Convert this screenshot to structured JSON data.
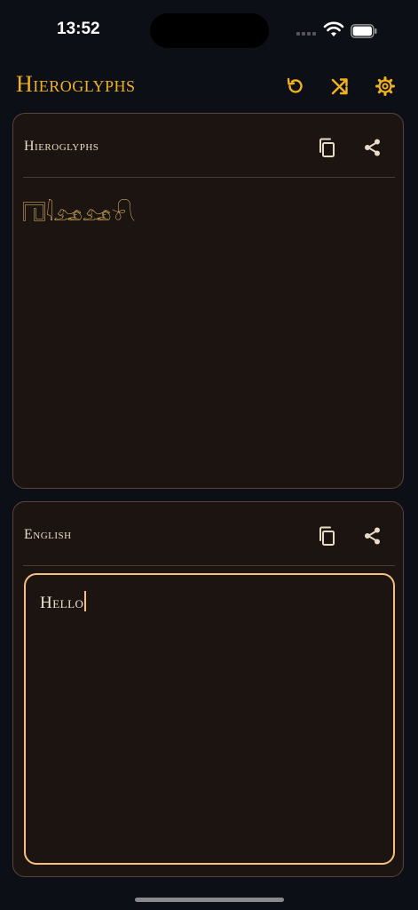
{
  "status_bar": {
    "time": "13:52"
  },
  "header": {
    "title": "Hieroglyphs",
    "accent_color": "#f2b21b",
    "icons": [
      "undo-icon",
      "shuffle-icon",
      "gear-icon"
    ]
  },
  "hieroglyphs_panel": {
    "label": "Hieroglyphs",
    "output_text": "𓉔𓇋𓃭𓃭𓍯",
    "icons": [
      "copy-icon",
      "share-icon"
    ]
  },
  "english_panel": {
    "label": "English",
    "input_value": "Hello",
    "icons": [
      "copy-icon",
      "share-icon"
    ]
  }
}
